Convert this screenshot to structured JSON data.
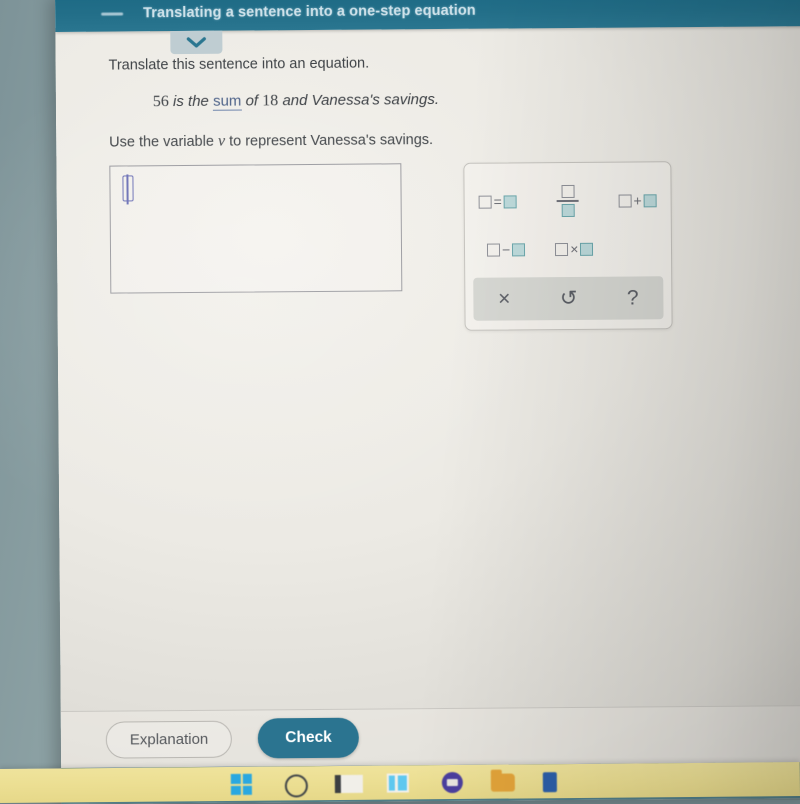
{
  "window": {
    "header_title": "Translating a sentence into a one-step equation",
    "menu_icon": "hamburger-icon",
    "chevron_icon": "chevron-down-icon"
  },
  "content": {
    "prompt": "Translate this sentence into an equation.",
    "sentence": {
      "num1": "56",
      "mid1": "is the ",
      "term": "sum",
      "mid2": " of ",
      "num2": "18",
      "tail": " and Vanessa's savings."
    },
    "variable_line": {
      "before": "Use the variable ",
      "variable": "v",
      "after": " to represent Vanessa's savings."
    },
    "answer_input": {
      "value": "",
      "placeholder": ""
    }
  },
  "palette": {
    "row1": [
      {
        "name": "equation-template",
        "left_box": "empty",
        "operator": "=",
        "right_box": "filled"
      },
      {
        "name": "fraction-template",
        "numerator": "empty",
        "denominator": "filled"
      },
      {
        "name": "addition-template",
        "left_box": "empty",
        "operator": "+",
        "right_box": "filled"
      }
    ],
    "row2": [
      {
        "name": "subtraction-template",
        "left_box": "empty",
        "operator": "−",
        "right_box": "filled"
      },
      {
        "name": "multiplication-template",
        "left_box": "empty",
        "operator": "×",
        "right_box": "filled"
      }
    ],
    "tools": [
      {
        "name": "clear-button",
        "glyph": "×"
      },
      {
        "name": "undo-button",
        "glyph": "↺"
      },
      {
        "name": "help-button",
        "glyph": "?"
      }
    ]
  },
  "footer": {
    "explanation_label": "Explanation",
    "check_label": "Check"
  },
  "taskbar": {
    "icons": [
      "windows-start-icon",
      "search-icon",
      "file-explorer-icon",
      "teams-icon",
      "media-app-icon",
      "folder-icon",
      "edge-icon"
    ]
  },
  "colors": {
    "header_teal": "#236f89",
    "check_button": "#2b7490",
    "box_fill_teal": "#bcd9da",
    "link_blue": "#4a5f86",
    "caret_purple": "#6a6fb5",
    "taskbar_yellow": "#ecdf93"
  }
}
